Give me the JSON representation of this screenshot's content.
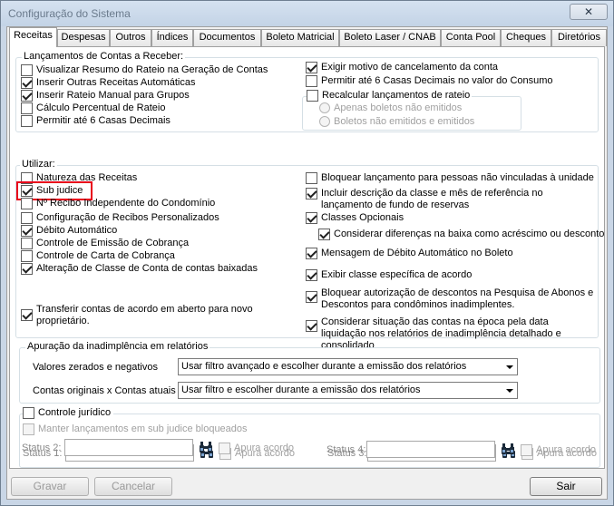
{
  "window": {
    "title": "Configuração do Sistema",
    "close_glyph": "✕"
  },
  "tabs": [
    "Receitas",
    "Despesas",
    "Outros",
    "Índices",
    "Documentos",
    "Boleto Matricial",
    "Boleto Laser / CNAB",
    "Conta Pool",
    "Cheques",
    "Diretórios"
  ],
  "lancamentos": {
    "legend": "Lançamentos de Contas a Receber:",
    "left": [
      {
        "label": "Visualizar Resumo do Rateio na Geração de Contas",
        "checked": false
      },
      {
        "label": "Inserir Outras Receitas Automáticas",
        "checked": true
      },
      {
        "label": "Inserir Rateio Manual para Grupos",
        "checked": true
      },
      {
        "label": "Cálculo Percentual de Rateio",
        "checked": false
      },
      {
        "label": "Permitir até 6 Casas Decimais",
        "checked": false
      }
    ],
    "right": [
      {
        "label": "Exigir motivo de cancelamento da conta",
        "checked": true
      },
      {
        "label": "Permitir até 6 Casas Decimais no valor do Consumo",
        "checked": false
      }
    ],
    "recalc": {
      "label": "Recalcular lançamentos de rateio",
      "checked": false,
      "radios": [
        "Apenas boletos não emitidos",
        "Boletos não emitidos e emitidos"
      ]
    }
  },
  "utilizar": {
    "legend": "Utilizar:",
    "left": [
      {
        "label": "Natureza das Receitas",
        "checked": false
      },
      {
        "label": "Sub judice",
        "checked": true
      },
      {
        "label": "Nº Recibo Independente do Condomínio",
        "checked": false
      },
      {
        "label": "Configuração de Recibos Personalizados",
        "checked": false
      },
      {
        "label": "Débito Automático",
        "checked": true
      },
      {
        "label": "Controle de Emissão de Cobrança",
        "checked": false
      },
      {
        "label": "Controle de Carta de Cobrança",
        "checked": false
      },
      {
        "label": "Alteração de Classe de Conta de contas baixadas",
        "checked": true
      }
    ],
    "transferir": {
      "label": "Transferir contas de acordo em aberto para novo proprietário.",
      "checked": true
    },
    "right": [
      {
        "label": "Bloquear lançamento para pessoas não vinculadas à unidade",
        "checked": false
      },
      {
        "label": "Incluir descrição da classe e mês de referência no lançamento de fundo de reservas",
        "checked": true
      },
      {
        "label": "Classes Opcionais",
        "checked": true
      },
      {
        "label": "Considerar diferenças na baixa como acréscimo ou desconto",
        "checked": true
      },
      {
        "label": "Mensagem de Débito Automático no Boleto",
        "checked": true
      },
      {
        "label": "Exibir classe específica de acordo",
        "checked": true
      },
      {
        "label": "Bloquear autorização de descontos na Pesquisa de Abonos e Descontos para condôminos inadimplentes.",
        "checked": true
      },
      {
        "label": "Considerar situação das contas na época pela data liquidação nos relatórios de inadimplência detalhado e consolidado",
        "checked": true
      }
    ]
  },
  "apuracao": {
    "legend": "Apuração da inadimplência em relatórios",
    "valores_label": "Valores zerados e negativos",
    "valores_value": "Usar filtro avançado e escolher durante a emissão dos relatórios",
    "originais_label": "Contas originais x Contas atuais",
    "originais_value": "Usar filtro e escolher durante a emissão dos relatórios"
  },
  "juridico": {
    "label": "Controle jurídico",
    "checked": false,
    "manter_label": "Manter lançamentos em sub judice bloqueados",
    "status": [
      "Status 1:",
      "Status 2:",
      "Status 3:",
      "Status 4:"
    ],
    "apura_label": "Apura acordo"
  },
  "buttons": {
    "gravar": "Gravar",
    "cancelar": "Cancelar",
    "sair": "Sair"
  }
}
